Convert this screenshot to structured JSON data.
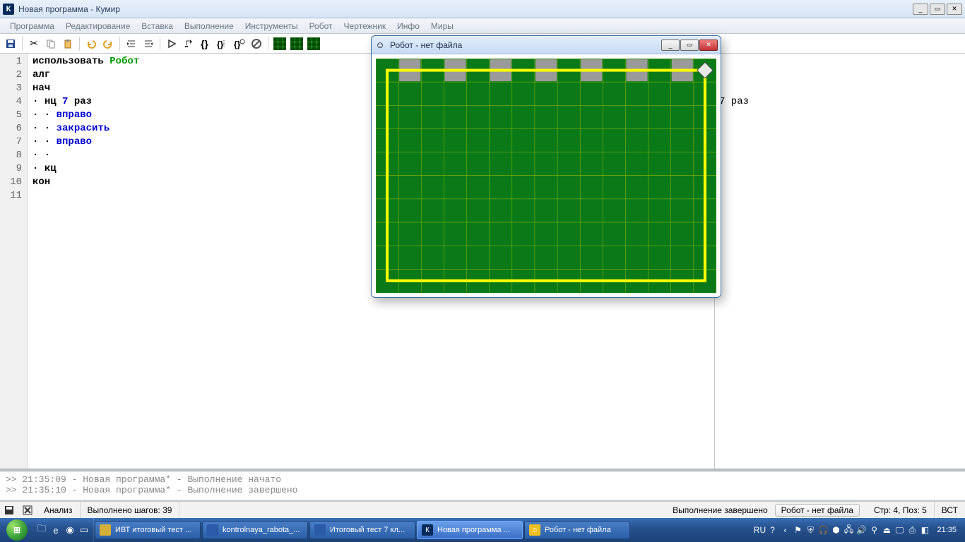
{
  "title": "Новая программа - Кумир",
  "title_icon_letter": "К",
  "menu": [
    "Программа",
    "Редактирование",
    "Вставка",
    "Выполнение",
    "Инструменты",
    "Робот",
    "Чертежник",
    "Инфо",
    "Миры"
  ],
  "code_lines": [
    {
      "n": 1,
      "parts": [
        {
          "t": "использовать",
          "c": "kw"
        },
        {
          "t": " "
        },
        {
          "t": "Робот",
          "c": "ident"
        }
      ]
    },
    {
      "n": 2,
      "parts": [
        {
          "t": "алг",
          "c": "kw"
        }
      ]
    },
    {
      "n": 3,
      "parts": [
        {
          "t": "нач",
          "c": "kw"
        }
      ]
    },
    {
      "n": 4,
      "parts": [
        {
          "t": "· ",
          "c": "dot"
        },
        {
          "t": "нц",
          "c": "kw"
        },
        {
          "t": " "
        },
        {
          "t": "7",
          "c": "num"
        },
        {
          "t": " "
        },
        {
          "t": "раз",
          "c": "kw"
        }
      ]
    },
    {
      "n": 5,
      "parts": [
        {
          "t": "· · ",
          "c": "dot"
        },
        {
          "t": "вправо",
          "c": "cmd"
        }
      ]
    },
    {
      "n": 6,
      "parts": [
        {
          "t": "· · ",
          "c": "dot"
        },
        {
          "t": "закрасить",
          "c": "cmd"
        }
      ]
    },
    {
      "n": 7,
      "parts": [
        {
          "t": "· · ",
          "c": "dot"
        },
        {
          "t": "вправо",
          "c": "cmd"
        }
      ]
    },
    {
      "n": 8,
      "parts": [
        {
          "t": "· ·",
          "c": "dot"
        }
      ]
    },
    {
      "n": 9,
      "parts": [
        {
          "t": "· ",
          "c": "dot"
        },
        {
          "t": "кц",
          "c": "kw"
        }
      ]
    },
    {
      "n": 10,
      "parts": [
        {
          "t": "кон",
          "c": "kw"
        }
      ]
    },
    {
      "n": 11,
      "parts": []
    }
  ],
  "side_fragment": "7  раз",
  "log": [
    ">> 21:35:09 - Новая программа* - Выполнение начато",
    ">> 21:35:10 - Новая программа* - Выполнение завершено"
  ],
  "status": {
    "analysis": "Анализ",
    "steps": "Выполнено шагов: 39",
    "exec": "Выполнение завершено",
    "robot_btn": "Робот - нет файла",
    "pos": "Стр: 4, Поз: 5",
    "mode": "ВСТ"
  },
  "robot_window": {
    "title": "Робот - нет файла",
    "grid": {
      "cols": 15,
      "rows": 10
    },
    "painted_cells": [
      [
        1,
        0
      ],
      [
        3,
        0
      ],
      [
        5,
        0
      ],
      [
        7,
        0
      ],
      [
        9,
        0
      ],
      [
        11,
        0
      ],
      [
        13,
        0
      ]
    ],
    "robot_cell": [
      14,
      0
    ]
  },
  "taskbar": {
    "items": [
      {
        "label": "ИВТ итоговый тест ...",
        "icon_bg": "#d4b038"
      },
      {
        "label": "kontrolnaya_rabota_...",
        "icon_bg": "#2a5aa8"
      },
      {
        "label": "Итоговый тест 7 кл...",
        "icon_bg": "#2a5aa8"
      },
      {
        "label": "Новая программа ...",
        "icon_bg": "#062a5a",
        "active": true,
        "icon_text": "К"
      },
      {
        "label": "Робот - нет файла",
        "icon_bg": "#f0c020",
        "icon_text": "☺"
      }
    ],
    "lang": "RU",
    "clock": "21:35"
  },
  "win_buttons": {
    "min": "_",
    "max": "▭",
    "close": "✕"
  }
}
